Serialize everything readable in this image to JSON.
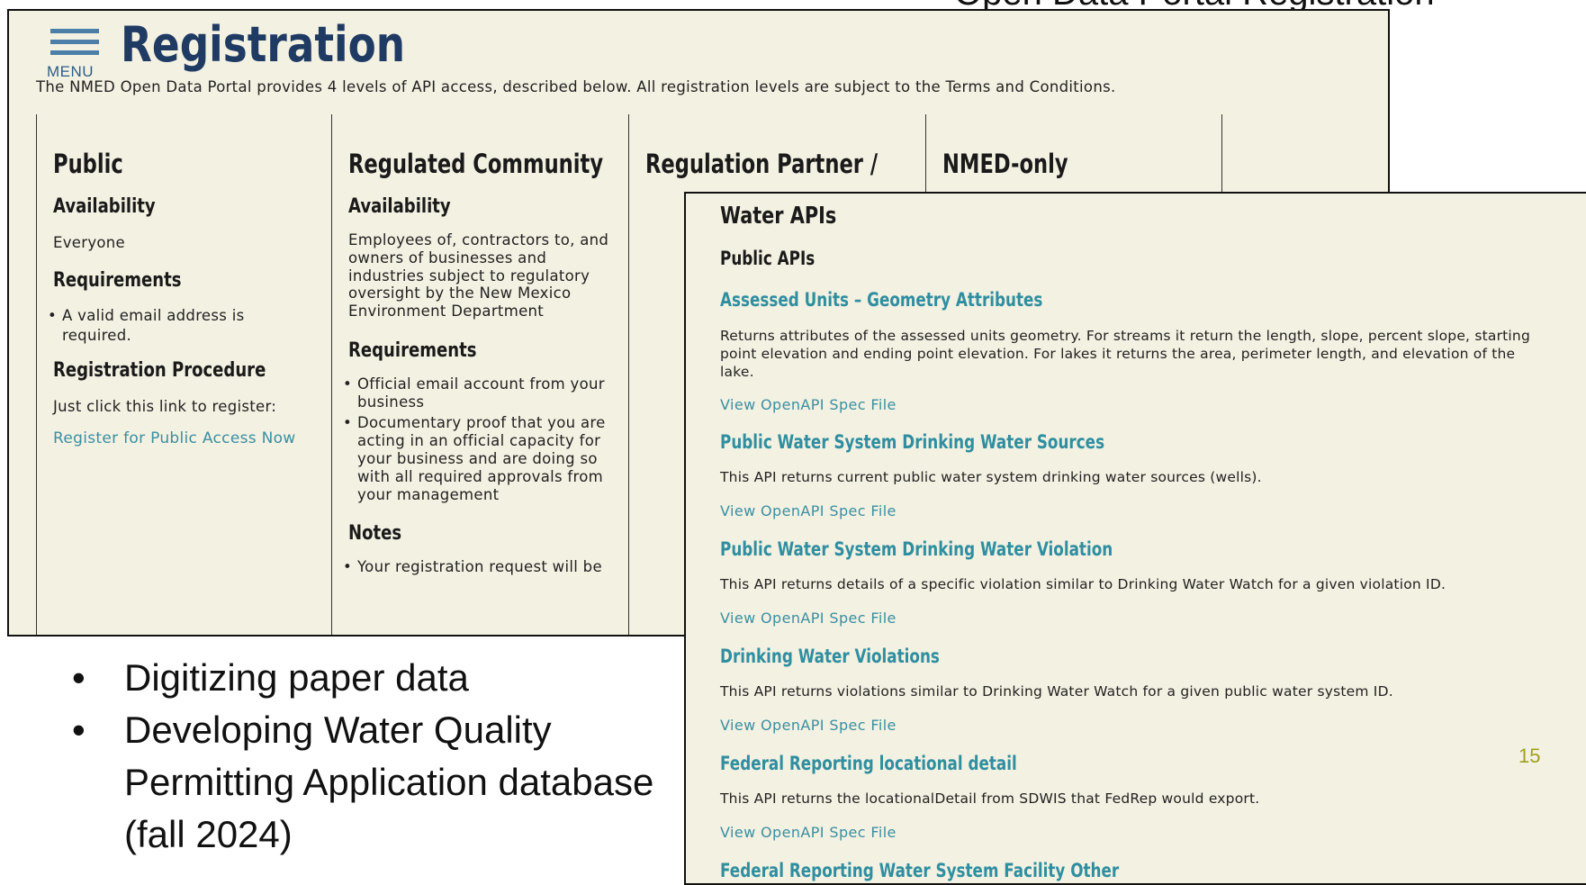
{
  "slide": {
    "cut_title": "Open Data Portal Registration",
    "bullets": [
      "Digitizing paper data",
      "Developing Water Quality Permitting Application database (fall 2024)"
    ],
    "page_number": "15"
  },
  "registration": {
    "menu_label": "MENU",
    "title": "Registration",
    "intro": "The NMED Open Data Portal provides 4 levels of API access, described below. All registration levels are subject to the Terms and Conditions.",
    "columns": [
      {
        "heading": "Public",
        "availability_label": "Availability",
        "availability": "Everyone",
        "requirements_label": "Requirements",
        "requirements": [
          "A valid email address is required."
        ],
        "procedure_label": "Registration Procedure",
        "procedure_text": "Just click this link to register:",
        "procedure_link": "Register for Public Access Now"
      },
      {
        "heading": "Regulated Community",
        "availability_label": "Availability",
        "availability": "Employees of, contractors to, and owners of businesses and industries subject to regulatory oversight by the New Mexico Environment Department",
        "requirements_label": "Requirements",
        "requirements": [
          "Official email account from your business",
          "Documentary proof that you are acting in an official capacity for your business and are doing so with all required approvals from your management"
        ],
        "notes_label": "Notes",
        "notes": [
          "Your registration request will be"
        ]
      },
      {
        "heading": "Regulation Partner /"
      },
      {
        "heading": "NMED-only"
      }
    ]
  },
  "water_apis": {
    "title": "Water APIs",
    "section": "Public APIs",
    "spec_link_label": "View OpenAPI Spec File",
    "items": [
      {
        "title": "Assessed Units – Geometry Attributes",
        "description": "Returns attributes of the assessed units geometry. For streams it return the length, slope, percent slope, starting point elevation and ending point elevation. For lakes it returns the area, perimeter length, and elevation of the lake."
      },
      {
        "title": "Public Water System Drinking Water Sources",
        "description": "This API returns current public water system drinking water sources (wells)."
      },
      {
        "title": "Public Water System Drinking Water Violation",
        "description": "This API returns details of a specific violation similar to Drinking Water Watch for a given violation ID."
      },
      {
        "title": "Drinking Water Violations",
        "description": "This API returns violations similar to Drinking Water Watch for a given public water system ID."
      },
      {
        "title": "Federal Reporting locational detail",
        "description": "This API returns the locationalDetail from SDWIS that FedRep would export."
      },
      {
        "title": "Federal Reporting Water System Facility Other"
      }
    ]
  }
}
